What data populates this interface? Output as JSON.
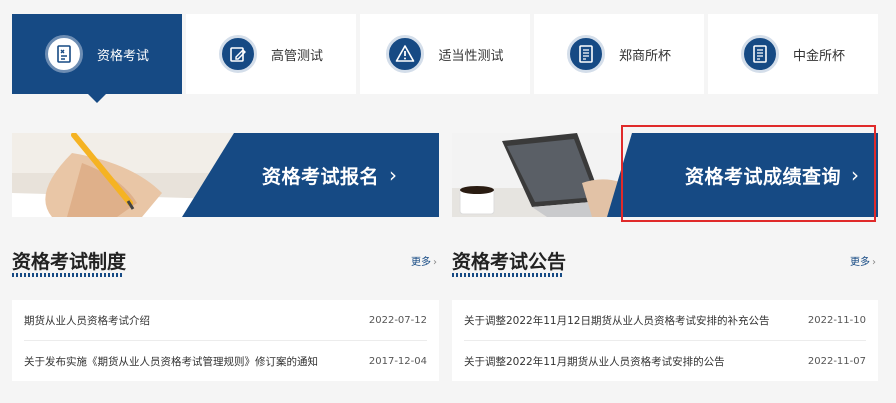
{
  "tabs": [
    {
      "label": "资格考试",
      "icon": "exam-sheet-icon",
      "active": true
    },
    {
      "label": "高管测试",
      "icon": "edit-document-icon",
      "active": false
    },
    {
      "label": "适当性测试",
      "icon": "warning-icon",
      "active": false
    },
    {
      "label": "郑商所杯",
      "icon": "document-icon",
      "active": false
    },
    {
      "label": "中金所杯",
      "icon": "document-icon",
      "active": false
    }
  ],
  "banners": {
    "register": {
      "label": "资格考试报名",
      "chevron": "›"
    },
    "score_query": {
      "label": "资格考试成绩查询",
      "chevron": "›"
    }
  },
  "sections": {
    "system": {
      "title": "资格考试制度",
      "more": "更多",
      "items": [
        {
          "title": "期货从业人员资格考试介绍",
          "date": "2022-07-12"
        },
        {
          "title": "关于发布实施《期货从业人员资格考试管理规则》修订案的通知",
          "date": "2017-12-04"
        }
      ]
    },
    "notice": {
      "title": "资格考试公告",
      "more": "更多",
      "items": [
        {
          "title": "关于调整2022年11月12日期货从业人员资格考试安排的补充公告",
          "date": "2022-11-10"
        },
        {
          "title": "关于调整2022年11月期货从业人员资格考试安排的公告",
          "date": "2022-11-07"
        }
      ]
    }
  },
  "colors": {
    "brand": "#164a84",
    "highlight": "#e02a2a"
  }
}
